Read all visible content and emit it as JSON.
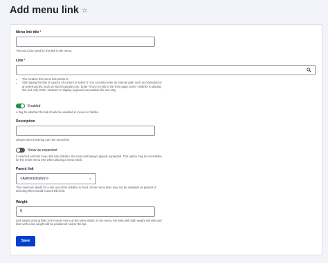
{
  "page": {
    "title": "Add menu link",
    "favorite_icon": "star-icon"
  },
  "title_field": {
    "label": "Menu link title",
    "required_mark": "*",
    "value": "",
    "description": "The text to be used for this link in the menu."
  },
  "link_field": {
    "label": "Link",
    "required_mark": "*",
    "value": "",
    "icon": "search-icon",
    "help": [
      "The location this menu link points to.",
      "Start typing the title of a piece of content to select it. You can also enter an internal path such as /node/add or an external URL such as http://example.com. Enter <front> to link to the front page. Enter <nolink> to display link text only. Enter <button> to display keyboard-accessible link text only."
    ]
  },
  "enabled": {
    "label": "Enabled",
    "checked": true,
    "description": "A flag for whether the link should be enabled in menus or hidden."
  },
  "description_field": {
    "label": "Description",
    "value": "",
    "description": "Shown when hovering over the menu link."
  },
  "expanded": {
    "label": "Show as expanded",
    "checked": false,
    "description": "If selected and this menu link has children, the menu will always appear expanded. This option may be overridden for the entire menu tree when placing a menu block."
  },
  "parent": {
    "label": "Parent link",
    "selected": "<Administration>",
    "description": "The maximum depth for a link and all its children is fixed. Some menu links may not be available as parents if selecting them would exceed this limit."
  },
  "weight": {
    "label": "Weight",
    "value": "0",
    "description": "Link weight among links in the same menu at the same depth. In the menu, the links with high weight will sink and links with a low weight will be positioned nearer the top."
  },
  "actions": {
    "save_label": "Save"
  },
  "colors": {
    "accent": "#003ecc",
    "toggle_on": "#238b4c",
    "required": "#d72222"
  }
}
